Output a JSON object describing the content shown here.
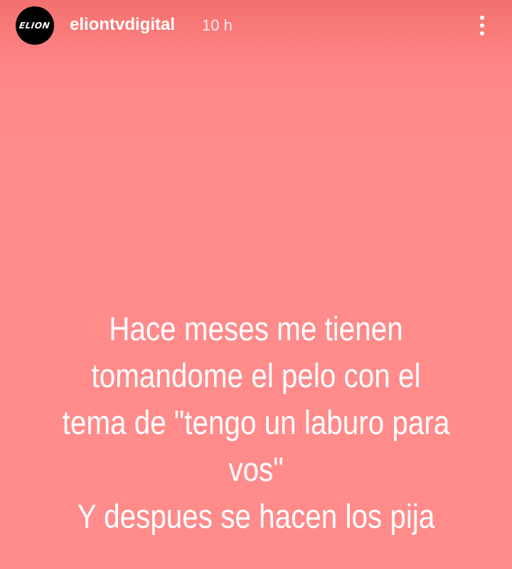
{
  "header": {
    "avatar_text": "ELION",
    "username": "eliontvdigital",
    "timestamp": "10 h",
    "more_icon": "vertical-ellipsis-icon"
  },
  "story": {
    "background_color": "#ff8b8b",
    "text_color": "#ffffff",
    "lines": [
      "Hace meses me tienen",
      "tomandome el pelo con el",
      "tema de \"tengo un laburo para",
      "vos\"",
      "Y despues se hacen los pija"
    ]
  }
}
